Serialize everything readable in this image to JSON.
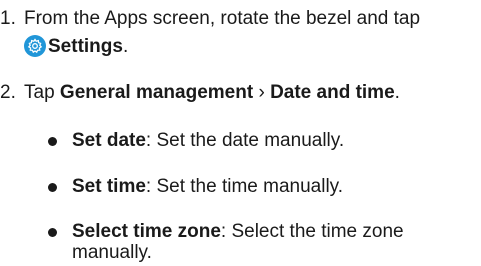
{
  "steps": [
    {
      "number": "1.",
      "line1": "From the Apps screen, rotate the bezel and tap",
      "icon": "settings-gear-icon",
      "line2_bold": "Settings",
      "line2_tail": "."
    },
    {
      "number": "2.",
      "prefix": "Tap ",
      "path_part1": "General management",
      "separator": " › ",
      "path_part2": "Date and time",
      "tail": "."
    }
  ],
  "bullets": [
    {
      "term": "Set date",
      "desc": ": Set the date manually."
    },
    {
      "term": "Set time",
      "desc": ": Set the time manually."
    },
    {
      "term": "Select time zone",
      "desc": ": Select the time zone",
      "desc_line2": "manually."
    }
  ],
  "colors": {
    "text": "#1a1a1a",
    "icon_bg": "#2196d8"
  }
}
